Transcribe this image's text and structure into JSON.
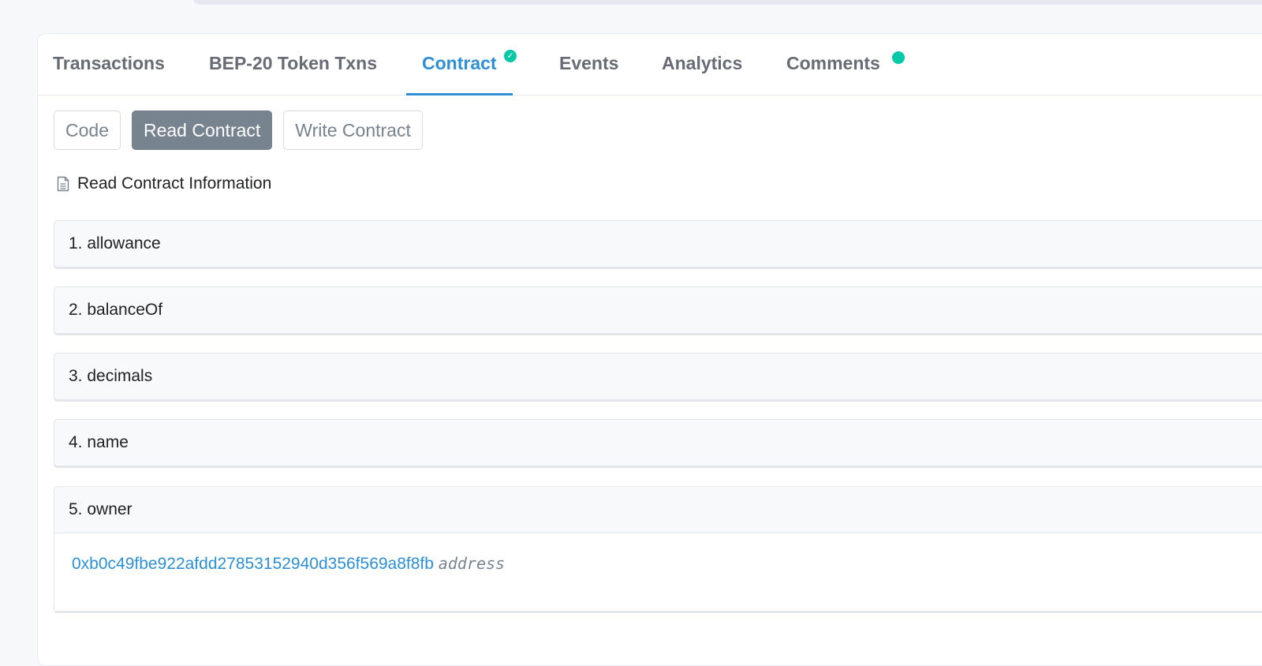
{
  "tabs": [
    {
      "label": "Transactions",
      "active": false
    },
    {
      "label": "BEP-20 Token Txns",
      "active": false
    },
    {
      "label": "Contract",
      "active": true,
      "badge": "verified-check"
    },
    {
      "label": "Events",
      "active": false
    },
    {
      "label": "Analytics",
      "active": false
    },
    {
      "label": "Comments",
      "active": false,
      "badge": "dot"
    }
  ],
  "subnav": {
    "code": "Code",
    "read_contract": "Read Contract",
    "write_contract": "Write Contract",
    "active": "Read Contract"
  },
  "section": {
    "icon": "document-icon",
    "title": "Read Contract Information"
  },
  "functions": [
    {
      "label": "1. allowance"
    },
    {
      "label": "2. balanceOf"
    },
    {
      "label": "3. decimals"
    },
    {
      "label": "4. name"
    },
    {
      "label": "5. owner",
      "expanded": true,
      "result": {
        "value": "0xb0c49fbe922afdd27853152940d356f569a8f8fb",
        "type": "address"
      }
    }
  ],
  "colors": {
    "accent": "#2e8fd6",
    "badge": "#00c9a7",
    "tab_text": "#676b73",
    "button_active": "#77838f"
  }
}
